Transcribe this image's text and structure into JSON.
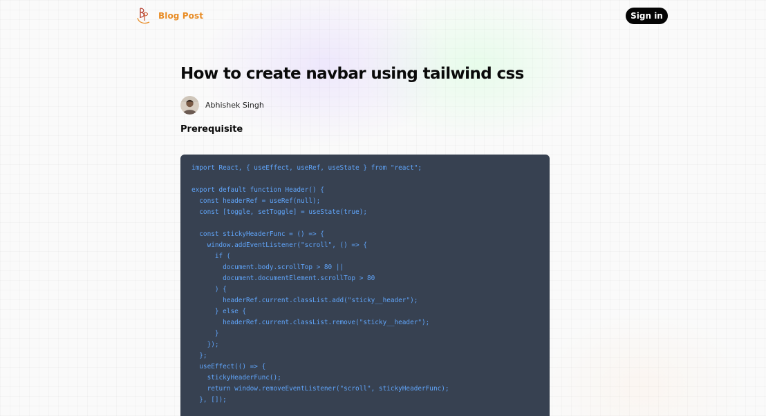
{
  "brand": {
    "logo_icon": "bp-monogram-logo",
    "name": "Blog Post",
    "color": "#e88c25"
  },
  "header": {
    "signin_label": "Sign in"
  },
  "article": {
    "title": "How to create navbar using tailwind css",
    "author": {
      "name": "Abhishek Singh",
      "avatar_icon": "author-avatar"
    },
    "section_heading": "Prerequisite",
    "code": {
      "background": "#374151",
      "text_color": "#60a5fa",
      "lines": [
        "import React, { useEffect, useRef, useState } from \"react\";",
        "",
        "export default function Header() {",
        "  const headerRef = useRef(null);",
        "  const [toggle, setToggle] = useState(true);",
        "",
        "  const stickyHeaderFunc = () => {",
        "    window.addEventListener(\"scroll\", () => {",
        "      if (",
        "        document.body.scrollTop > 80 ||",
        "        document.documentElement.scrollTop > 80",
        "      ) {",
        "        headerRef.current.classList.add(\"sticky__header\");",
        "      } else {",
        "        headerRef.current.classList.remove(\"sticky__header\");",
        "      }",
        "    });",
        "  };",
        "  useEffect(() => {",
        "    stickyHeaderFunc();",
        "    return window.removeEventListener(\"scroll\", stickyHeaderFunc);",
        "  }, []);"
      ]
    }
  }
}
